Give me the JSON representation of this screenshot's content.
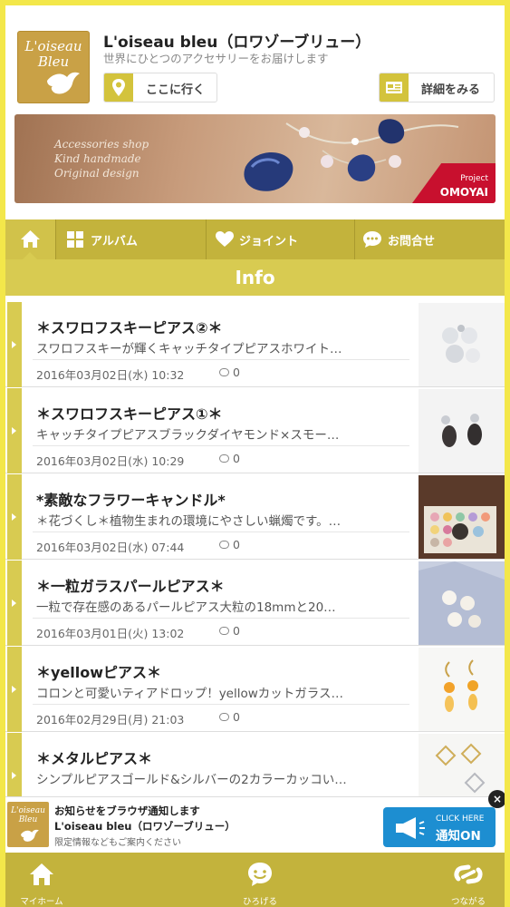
{
  "header": {
    "logo_text": "L'oiseau Bleu",
    "shop_name": "L'oiseau bleu（ロワゾーブリュー）",
    "tagline": "世界にひとつのアクセサリーをお届けします",
    "go_button": "ここに行く",
    "detail_button": "詳細をみる"
  },
  "banner": {
    "lines": [
      "Accessories shop",
      "Kind handmade",
      "Original design"
    ],
    "badge_small": "Project",
    "badge_big": "OMOYAI"
  },
  "nav": {
    "items": [
      {
        "label": "アルバム"
      },
      {
        "label": "ジョイント"
      },
      {
        "label": "お問合せ"
      }
    ]
  },
  "section_title": "Info",
  "posts": [
    {
      "title": "＊スワロフスキーピアス②＊",
      "excerpt": "スワロフスキーが輝くキャッチタイプピアスホワイト…",
      "date": "2016年03月02日(水) 10:32",
      "comments": "0"
    },
    {
      "title": "＊スワロフスキーピアス①＊",
      "excerpt": "キャッチタイプピアスブラックダイヤモンド×スモー…",
      "date": "2016年03月02日(水) 10:29",
      "comments": "0"
    },
    {
      "title": "*素敵なフラワーキャンドル*",
      "excerpt": "＊花づくし＊植物生まれの環境にやさしい蝋燭です。…",
      "date": "2016年03月02日(水) 07:44",
      "comments": "0"
    },
    {
      "title": "＊一粒ガラスパールピアス＊",
      "excerpt": "一粒で存在感のあるパールピアス大粒の18mmと20…",
      "date": "2016年03月01日(火) 13:02",
      "comments": "0"
    },
    {
      "title": "＊yellowピアス＊",
      "excerpt": "コロンと可愛いティアドロップ！yellowカットガラス…",
      "date": "2016年02月29日(月) 21:03",
      "comments": "0"
    },
    {
      "title": "＊メタルピアス＊",
      "excerpt": "シンプルピアスゴールド&シルバーの2カラーカッコい…",
      "date": "",
      "comments": ""
    }
  ],
  "notify": {
    "logo_text": "L'oiseau Bleu",
    "line1": "お知らせをブラウザ通知します",
    "line2": "L'oiseau bleu（ロワゾーブリュー）",
    "line3": "限定情報などもご案内ください",
    "btn_small": "CLICK HERE",
    "btn_big": "通知ON",
    "close": "×"
  },
  "tabbar": [
    {
      "label": "マイホーム",
      "icon": "home-icon"
    },
    {
      "label": "ひろげる",
      "icon": "chat-icon"
    },
    {
      "label": "つながる",
      "icon": "link-icon"
    }
  ],
  "colors": {
    "frame": "#f3e74a",
    "olive": "#c3b33c",
    "accent": "#d8cb51",
    "logo": "#c9a146",
    "notify_button": "#1d8ed1"
  }
}
